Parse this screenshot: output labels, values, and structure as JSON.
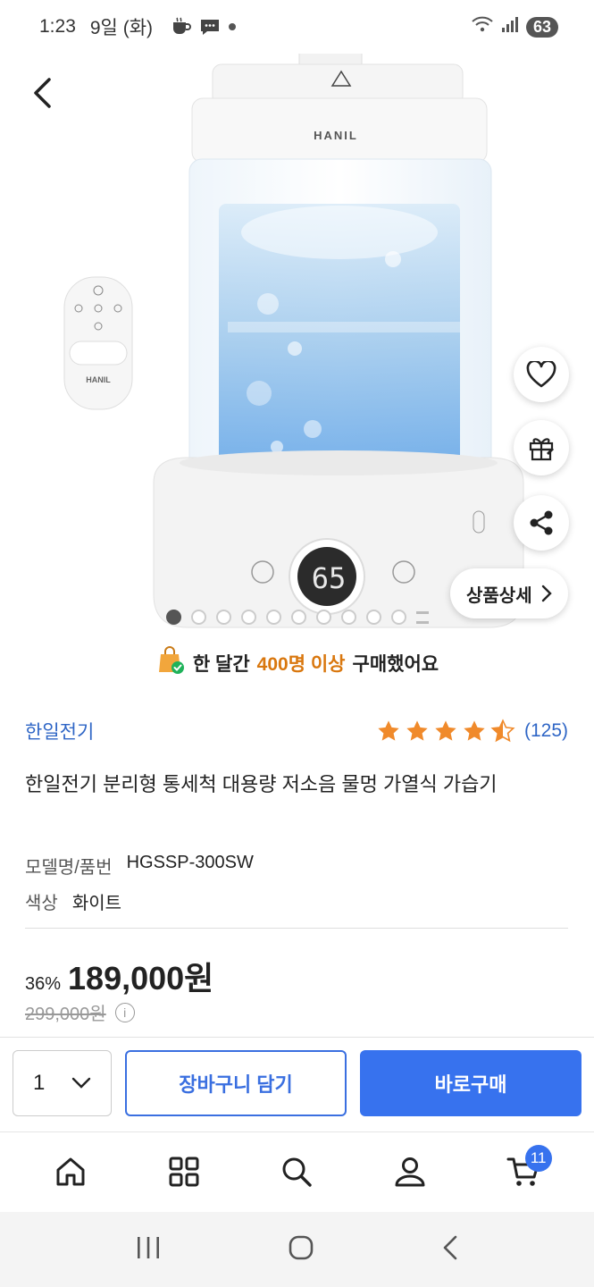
{
  "status_bar": {
    "time": "1:23",
    "date": "9일 (화)",
    "battery": "63"
  },
  "hero": {
    "product_image_logo": "HANIL",
    "remote_logo": "HANIL",
    "display_reading": "65",
    "detail_button_label": "상품상세",
    "slide_count": 10,
    "active_slide": 1
  },
  "notice": {
    "prefix": "한 달간",
    "highlight": "400명 이상",
    "suffix": "구매했어요"
  },
  "product": {
    "brand": "한일전기",
    "rating": 4.5,
    "review_count": "(125)",
    "title": "한일전기 분리형 통세척 대용량 저소음 물멍 가열식 가습기",
    "model_label": "모델명/품번",
    "model_value": "HGSSP-300SW",
    "color_label": "색상",
    "color_value": "화이트",
    "discount": "36%",
    "price": "189,000원",
    "original_price": "299,000원"
  },
  "action_bar": {
    "quantity": "1",
    "cart_label": "장바구니 담기",
    "buy_label": "바로구매"
  },
  "bottom_nav": {
    "cart_badge": "11"
  },
  "colors": {
    "brand_blue": "#3772ee",
    "star_orange": "#f08a2b",
    "highlight_orange": "#d9770e"
  }
}
